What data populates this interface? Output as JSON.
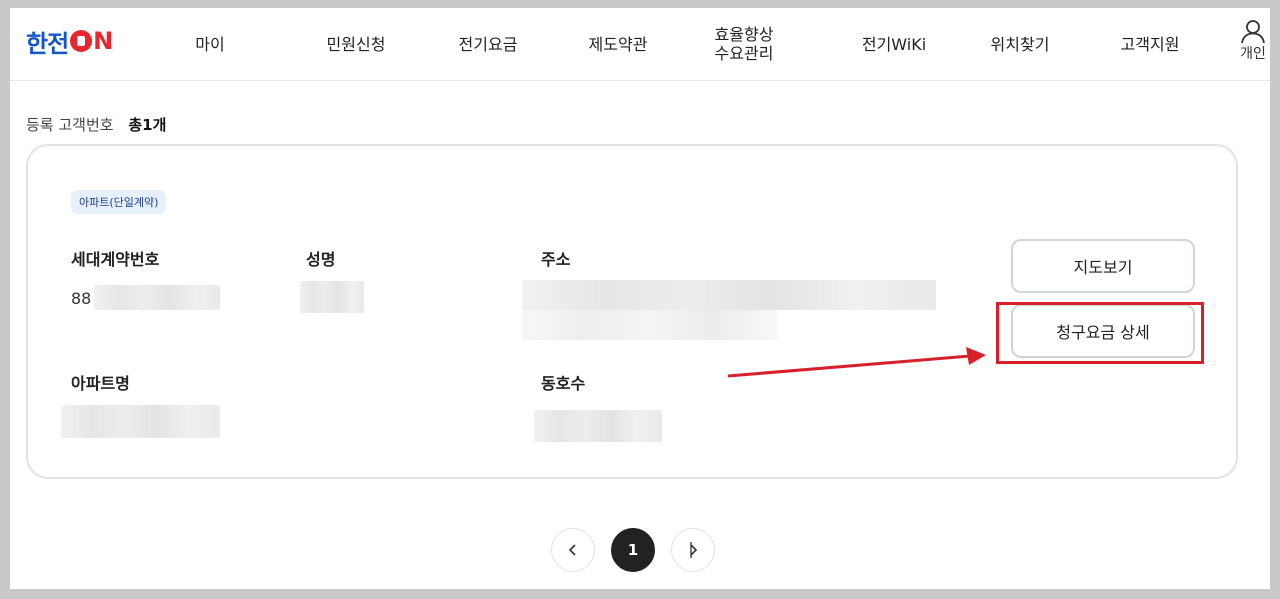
{
  "header": {
    "logo_text": "한전",
    "logo_on_n": "N",
    "nav": [
      {
        "label": "마이"
      },
      {
        "label": "민원신청"
      },
      {
        "label": "전기요금"
      },
      {
        "label": "제도약관"
      },
      {
        "label_line1": "효율향상",
        "label_line2": "수요관리"
      },
      {
        "label": "전기WiKi"
      },
      {
        "label": "위치찾기"
      },
      {
        "label": "고객지원"
      }
    ],
    "user_label": "개인"
  },
  "summary": {
    "label": "등록 고객번호",
    "total": "총1개"
  },
  "card": {
    "badge": "아파트(단일계약)",
    "contract_no": {
      "label": "세대계약번호",
      "value_prefix": "88"
    },
    "name": {
      "label": "성명"
    },
    "address": {
      "label": "주소"
    },
    "apt_name": {
      "label": "아파트명"
    },
    "unit": {
      "label": "동호수"
    },
    "buttons": {
      "map": "지도보기",
      "bill_detail": "청구요금 상세"
    }
  },
  "pagination": {
    "prev_icon": "chevron-left-icon",
    "current_page": "1",
    "next_icon": "chevron-right-icon"
  },
  "colors": {
    "brand_blue": "#1457c8",
    "brand_red": "#e8262d",
    "highlight_red": "#d8202a",
    "badge_bg": "#e7effb"
  }
}
